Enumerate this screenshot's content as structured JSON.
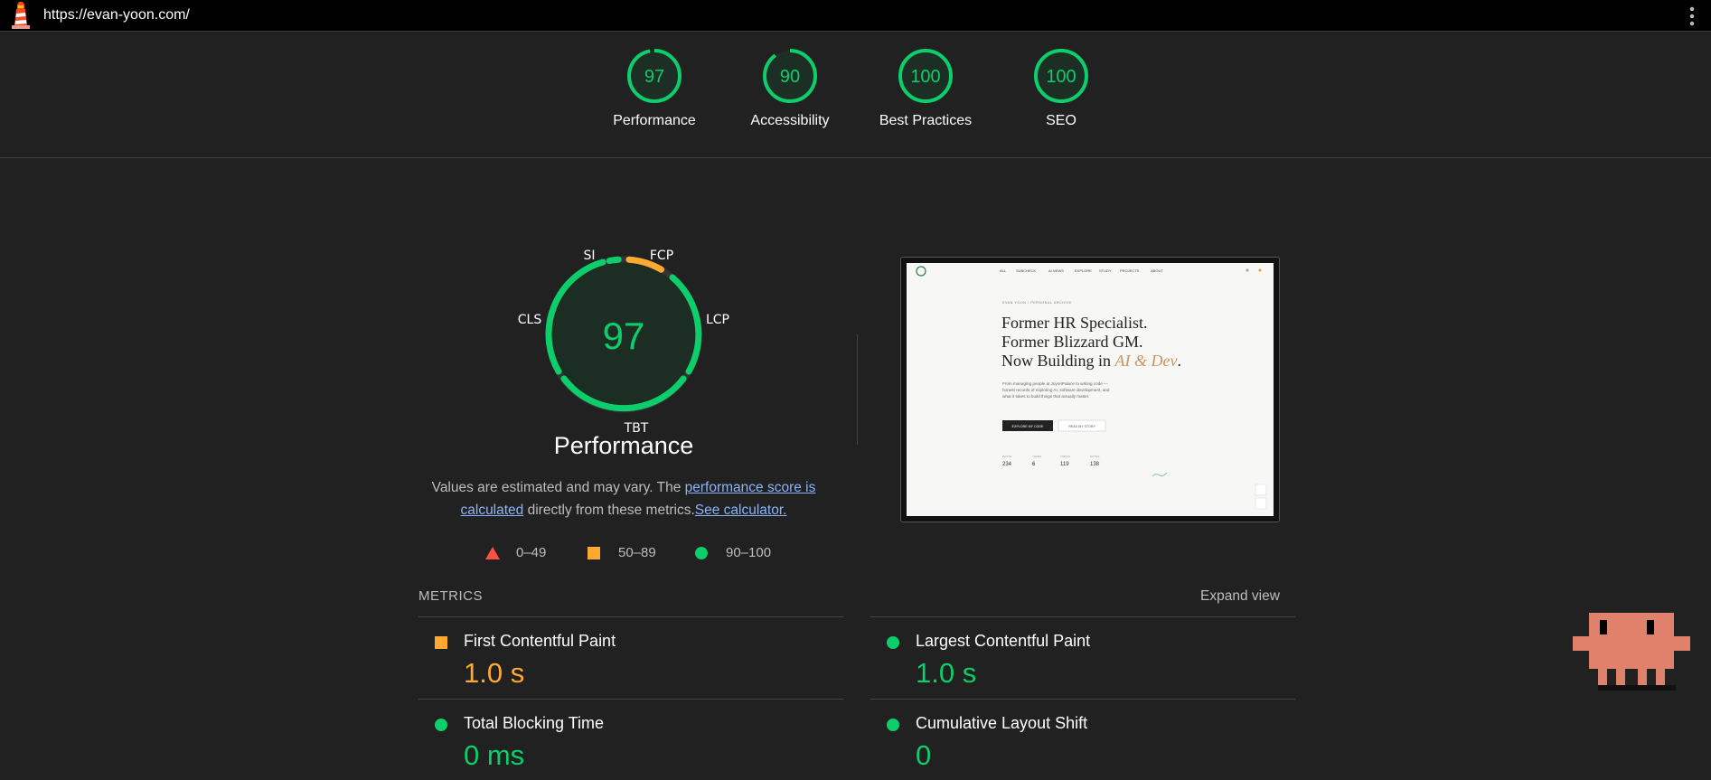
{
  "topbar": {
    "url": "https://evan-yoon.com/"
  },
  "colors": {
    "pass": "#0cce6b",
    "average": "#ffa931",
    "fail": "#ff4e42",
    "link": "#8ab4f8"
  },
  "gauges": [
    {
      "score": "97",
      "label": "Performance"
    },
    {
      "score": "90",
      "label": "Accessibility"
    },
    {
      "score": "100",
      "label": "Best Practices"
    },
    {
      "score": "100",
      "label": "SEO"
    }
  ],
  "performance": {
    "score": "97",
    "title": "Performance",
    "segments": [
      "SI",
      "FCP",
      "LCP",
      "TBT",
      "CLS"
    ],
    "desc_prefix": "Values are estimated and may vary. The ",
    "desc_link1": "performance score is calculated",
    "desc_mid": " directly from these metrics.",
    "desc_link2": "See calculator.",
    "legend": [
      {
        "range": "0–49",
        "shape": "triangle"
      },
      {
        "range": "50–89",
        "shape": "square"
      },
      {
        "range": "90–100",
        "shape": "circle"
      }
    ]
  },
  "screenshot": {
    "nav": [
      "ALL",
      "SUBCHECK",
      "AI NEWS",
      "EXPLORE",
      "STUDY",
      "PROJECTS",
      "ABOUT"
    ],
    "eyebrow": "EVAN YOON / PERSONAL ARCHIVE",
    "headline1": "Former HR Specialist.",
    "headline2": "Former Blizzard GM.",
    "headline3_pre": "Now Building in ",
    "headline3_accent": "AI & Dev",
    "headline3_post": ".",
    "body1": "From managing people at JoyonPalace to writing code —",
    "body2": "honest records of exploring AI, software development, and",
    "body3": "what it takes to build things that actually matter.",
    "btn_primary": "EXPLORE MY CODE",
    "btn_secondary": "READ MY STORY",
    "stats": [
      {
        "label": "POSTS",
        "value": "234"
      },
      {
        "label": "YEARS",
        "value": "6"
      },
      {
        "label": "TOPICS",
        "value": "119"
      },
      {
        "label": "NOTES",
        "value": "138"
      }
    ]
  },
  "metrics": {
    "header": "METRICS",
    "expand": "Expand view",
    "items": [
      {
        "name": "First Contentful Paint",
        "value": "1.0 s",
        "status": "average"
      },
      {
        "name": "Largest Contentful Paint",
        "value": "1.0 s",
        "status": "pass"
      },
      {
        "name": "Total Blocking Time",
        "value": "0 ms",
        "status": "pass"
      },
      {
        "name": "Cumulative Layout Shift",
        "value": "0",
        "status": "pass"
      }
    ]
  }
}
